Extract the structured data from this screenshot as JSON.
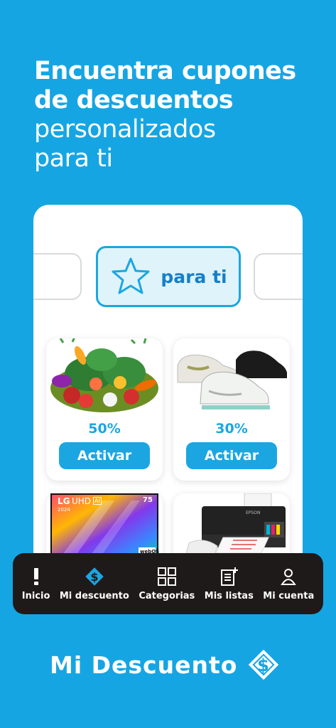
{
  "headline": {
    "line1": "Encuentra cupones",
    "line2": "de descuentos",
    "line3": "personalizados",
    "line4": "para ti"
  },
  "tabs": {
    "active_label": "para ti",
    "active_icon": "star-icon"
  },
  "products": [
    {
      "name": "vegetables",
      "discount": "50%",
      "button": "Activar"
    },
    {
      "name": "sneakers",
      "discount": "30%",
      "button": "Activar"
    },
    {
      "name": "television",
      "tv_brand": "LG",
      "tv_model": "UHD",
      "tv_ai": "AI",
      "tv_year": "2024",
      "tv_size": "75",
      "tv_os": "webOS"
    },
    {
      "name": "printer",
      "printer_brand": "EPSON"
    }
  ],
  "nav": {
    "items": [
      {
        "label": "Inicio",
        "icon": "exclamation-icon"
      },
      {
        "label": "Mi descuento",
        "icon": "discount-tag-icon"
      },
      {
        "label": "Categorias",
        "icon": "grid-icon"
      },
      {
        "label": "Mis listas",
        "icon": "list-add-icon"
      },
      {
        "label": "Mi cuenta",
        "icon": "person-icon"
      }
    ]
  },
  "brand": {
    "name": "Mi Descuento",
    "icon": "discount-tag-icon"
  },
  "colors": {
    "background": "#16a5e3",
    "accent": "#1ba6e2",
    "nav_bg": "#1f1a1a"
  }
}
